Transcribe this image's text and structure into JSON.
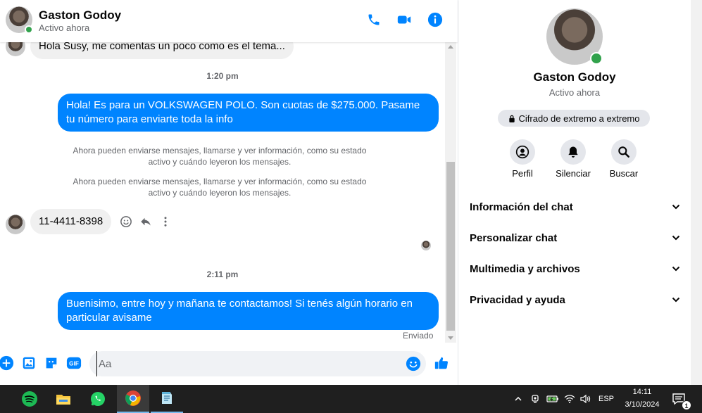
{
  "header": {
    "name": "Gaston Godoy",
    "status": "Activo ahora"
  },
  "messages": {
    "partial_incoming": "Hola Susy, me comentas un poco como es el tema...",
    "time_1": "1:20 pm",
    "outgoing_1": "Hola! Es para un VOLKSWAGEN POLO. Son cuotas de $275.000. Pasame tu número para enviarte toda la info",
    "system_1": "Ahora pueden enviarse mensajes, llamarse y ver información, como su estado activo y cuándo leyeron los mensajes.",
    "system_2": "Ahora pueden enviarse mensajes, llamarse y ver información, como su estado activo y cuándo leyeron los mensajes.",
    "incoming_1": "11-4411-8398",
    "time_2": "2:11 pm",
    "outgoing_2": "Buenisimo, entre hoy y mañana te contactamos! Si tenés algún horario en particular avisame",
    "sent_label": "Enviado"
  },
  "composer": {
    "placeholder": "Aa",
    "value": ""
  },
  "info_panel": {
    "name": "Gaston Godoy",
    "status": "Activo ahora",
    "encryption": "Cifrado de extremo a extremo",
    "actions": [
      {
        "label": "Perfil",
        "icon": "profile-icon"
      },
      {
        "label": "Silenciar",
        "icon": "bell-icon"
      },
      {
        "label": "Buscar",
        "icon": "search-icon"
      }
    ],
    "sections": [
      {
        "label": "Información del chat"
      },
      {
        "label": "Personalizar chat"
      },
      {
        "label": "Multimedia y archivos"
      },
      {
        "label": "Privacidad y ayuda"
      }
    ]
  },
  "taskbar": {
    "apps": [
      "spotify-icon",
      "file-explorer-icon",
      "whatsapp-icon",
      "chrome-icon",
      "notepad-icon"
    ],
    "language": "ESP",
    "time": "14:11",
    "date": "3/10/2024",
    "notification_count": "1"
  },
  "colors": {
    "accent": "#0084ff",
    "online": "#31a24c",
    "incoming_bubble": "#f0f0f0",
    "taskbar": "#1f1f1f"
  }
}
